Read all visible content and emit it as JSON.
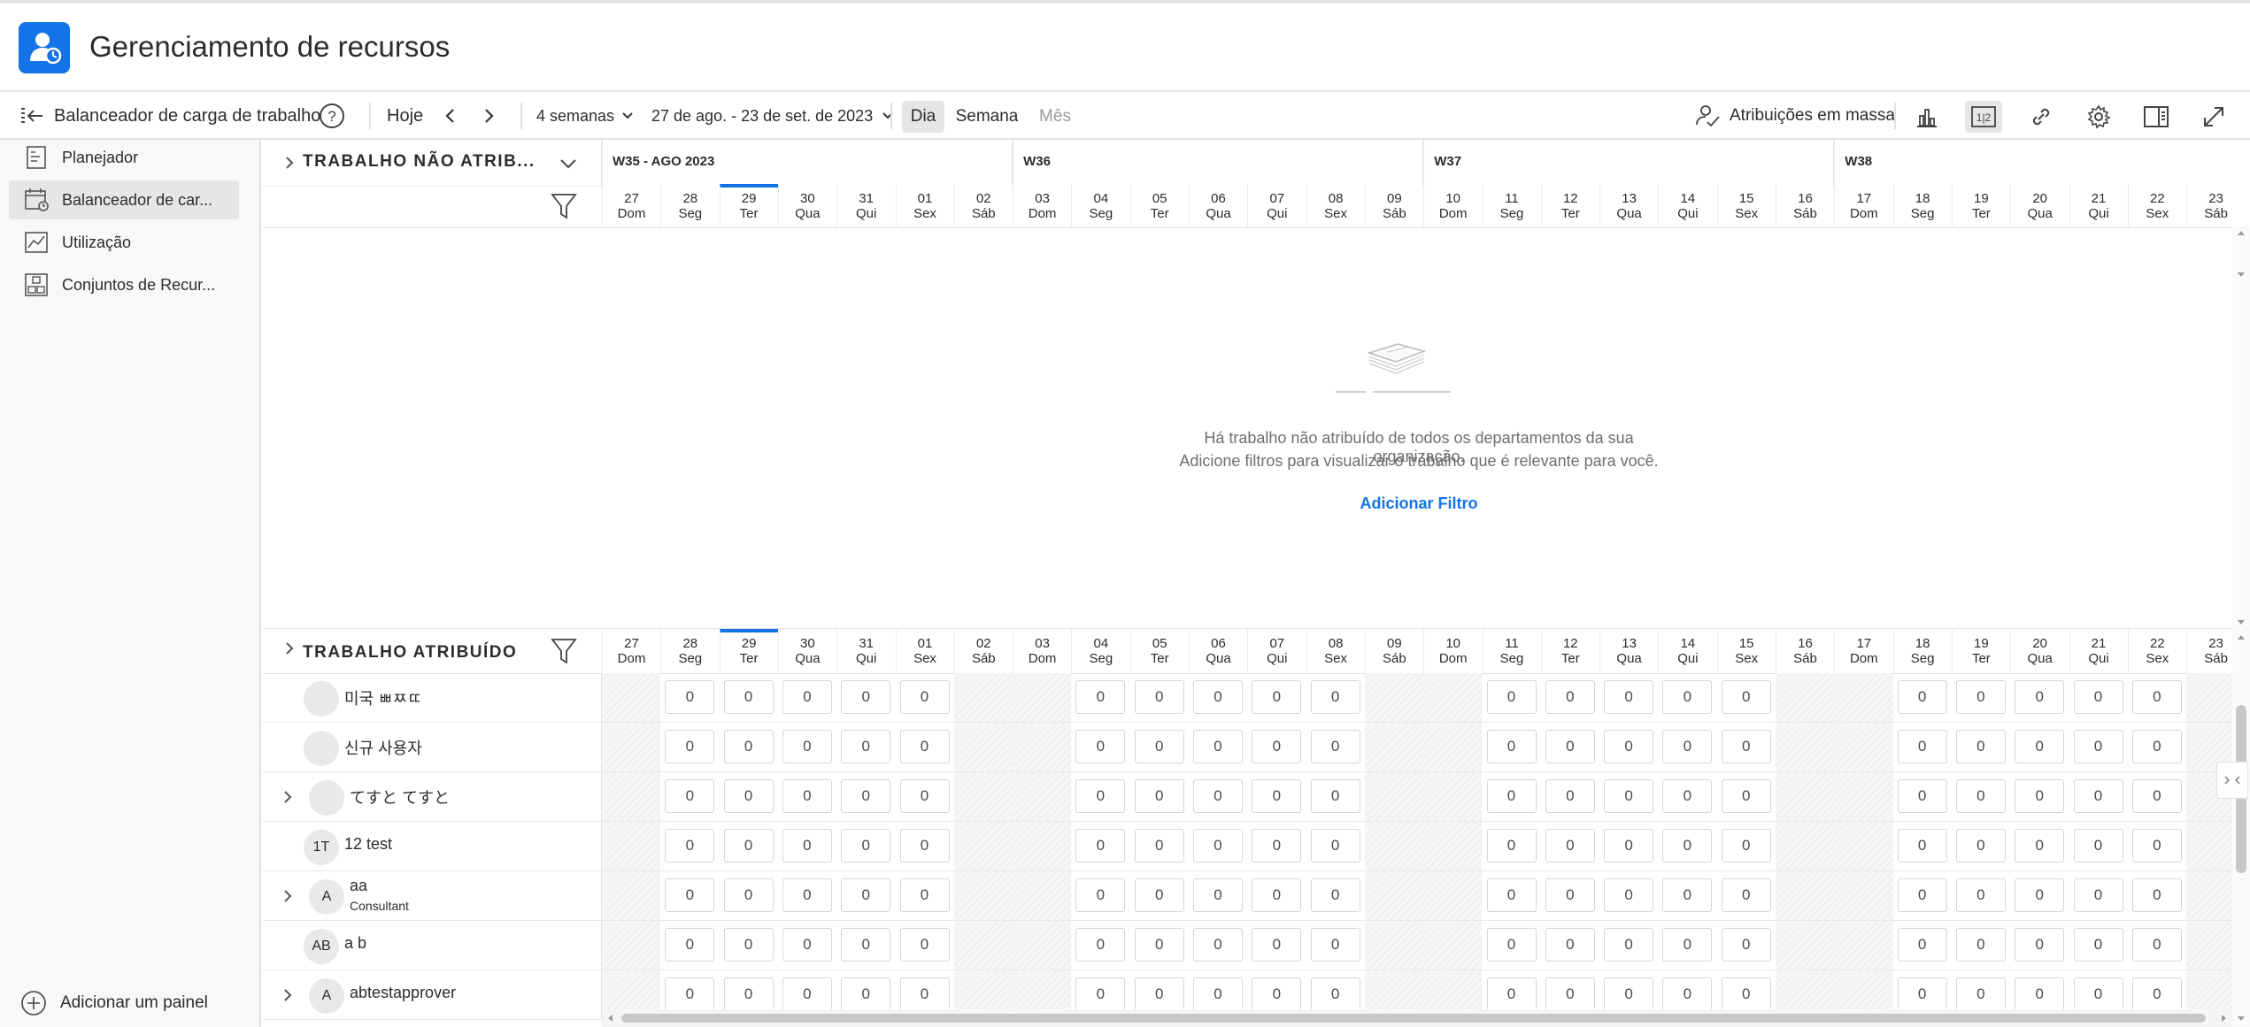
{
  "app": {
    "title": "Gerenciamento de recursos",
    "brand_color": "#1473e6"
  },
  "toolbar": {
    "view_title": "Balanceador de carga de trabalho",
    "today": "Hoje",
    "range_select": "4 semanas",
    "date_range": "27 de ago. - 23 de set. de 2023",
    "views": [
      "Dia",
      "Semana",
      "Mês"
    ],
    "selected_view": "Dia",
    "mass_assign": "Atribuições em massa"
  },
  "sidebar": {
    "items": [
      {
        "label": "Planejador",
        "icon": "planner-icon"
      },
      {
        "label": "Balanceador de car...",
        "icon": "workload-balancer-icon",
        "selected": true
      },
      {
        "label": "Utilização",
        "icon": "utilization-icon"
      },
      {
        "label": "Conjuntos de Recur...",
        "icon": "resource-pools-icon"
      }
    ],
    "add_panel": "Adicionar um painel"
  },
  "unassigned": {
    "label": "TRABALHO NÃO ATRIB...",
    "empty_line1": "Há trabalho não atribuído de todos os departamentos da sua organização.",
    "empty_line2": "Adicione filtros para visualizar o trabalho que é relevante para você.",
    "add_filter": "Adicionar Filtro"
  },
  "assigned": {
    "label": "TRABALHO ATRIBUÍDO"
  },
  "weeks": [
    "W35 - AGO 2023",
    "W36",
    "W37",
    "W38"
  ],
  "days": [
    {
      "n": "27",
      "d": "Dom",
      "weekend": true
    },
    {
      "n": "28",
      "d": "Seg"
    },
    {
      "n": "29",
      "d": "Ter",
      "today": true
    },
    {
      "n": "30",
      "d": "Qua"
    },
    {
      "n": "31",
      "d": "Qui"
    },
    {
      "n": "01",
      "d": "Sex"
    },
    {
      "n": "02",
      "d": "Sáb",
      "weekend": true
    },
    {
      "n": "03",
      "d": "Dom",
      "weekend": true
    },
    {
      "n": "04",
      "d": "Seg"
    },
    {
      "n": "05",
      "d": "Ter"
    },
    {
      "n": "06",
      "d": "Qua"
    },
    {
      "n": "07",
      "d": "Qui"
    },
    {
      "n": "08",
      "d": "Sex"
    },
    {
      "n": "09",
      "d": "Sáb",
      "weekend": true
    },
    {
      "n": "10",
      "d": "Dom",
      "weekend": true
    },
    {
      "n": "11",
      "d": "Seg"
    },
    {
      "n": "12",
      "d": "Ter"
    },
    {
      "n": "13",
      "d": "Qua"
    },
    {
      "n": "14",
      "d": "Qui"
    },
    {
      "n": "15",
      "d": "Sex"
    },
    {
      "n": "16",
      "d": "Sáb",
      "weekend": true
    },
    {
      "n": "17",
      "d": "Dom",
      "weekend": true
    },
    {
      "n": "18",
      "d": "Seg"
    },
    {
      "n": "19",
      "d": "Ter"
    },
    {
      "n": "20",
      "d": "Qua"
    },
    {
      "n": "21",
      "d": "Qui"
    },
    {
      "n": "22",
      "d": "Sex"
    },
    {
      "n": "23",
      "d": "Sáb",
      "weekend": true
    }
  ],
  "users": [
    {
      "name": "미국 ㅃㅉㄸ",
      "initials": "",
      "expandable": false
    },
    {
      "name": "신규 사용자",
      "initials": "",
      "expandable": false
    },
    {
      "name": "てすと てすと",
      "initials": "",
      "expandable": true
    },
    {
      "name": "12 test",
      "initials": "1T",
      "expandable": false
    },
    {
      "name": "aa",
      "role": "Consultant",
      "initials": "A",
      "expandable": true
    },
    {
      "name": "a b",
      "initials": "AB",
      "expandable": false
    },
    {
      "name": "abtestapprover",
      "initials": "A",
      "expandable": true
    }
  ],
  "cell_value": "0"
}
